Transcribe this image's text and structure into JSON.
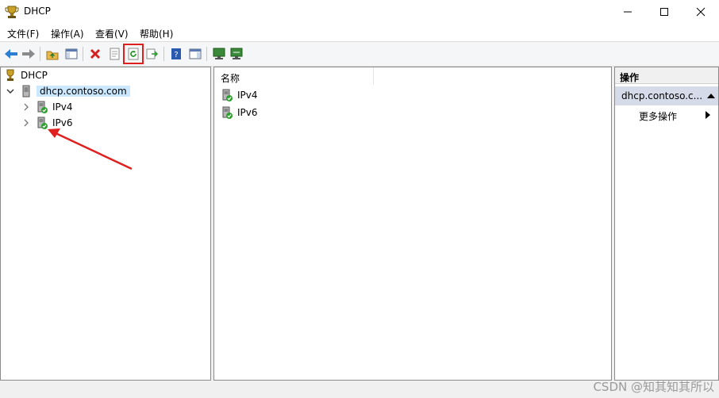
{
  "window": {
    "title": "DHCP"
  },
  "menu": [
    {
      "label": "文件(F)"
    },
    {
      "label": "操作(A)"
    },
    {
      "label": "查看(V)"
    },
    {
      "label": "帮助(H)"
    }
  ],
  "tree": {
    "root": "DHCP",
    "server": "dhcp.contoso.com",
    "children": [
      {
        "label": "IPv4"
      },
      {
        "label": "IPv6"
      }
    ]
  },
  "list": {
    "header": "名称",
    "items": [
      {
        "label": "IPv4"
      },
      {
        "label": "IPv6"
      }
    ]
  },
  "actions": {
    "header": "操作",
    "selected": "dhcp.contoso.c...",
    "more": "更多操作"
  },
  "annotation": {
    "color": "#e0201e",
    "target": "IPv6"
  },
  "watermark": "CSDN @知其知其所以"
}
